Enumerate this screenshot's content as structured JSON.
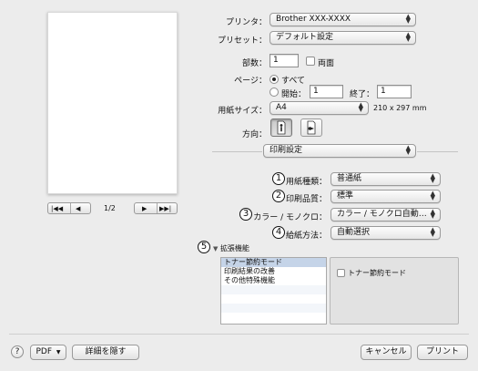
{
  "preview": {
    "page_counter": "1/2",
    "nav_first": "|◀◀",
    "nav_prev": "◀",
    "nav_next": "▶",
    "nav_last": "▶▶|"
  },
  "printer": {
    "label": "プリンタ：",
    "value": "Brother XXX-XXXX"
  },
  "preset": {
    "label": "プリセット：",
    "value": "デフォルト設定"
  },
  "copies": {
    "label": "部数：",
    "value": "1",
    "duplex_label": "両面",
    "duplex_checked": false
  },
  "pages": {
    "label": "ページ：",
    "all_label": "すべて",
    "from_label": "開始：",
    "from_value": "1",
    "to_label": "終了：",
    "to_value": "1",
    "selected": "all"
  },
  "paper_size": {
    "label": "用紙サイズ：",
    "value": "A4",
    "dimensions": "210 x 297 mm"
  },
  "orientation": {
    "label": "方向："
  },
  "section": {
    "value": "印刷設定"
  },
  "settings": [
    {
      "number": "1",
      "label": "用紙種類：",
      "value": "普通紙"
    },
    {
      "number": "2",
      "label": "印刷品質：",
      "value": "標準"
    },
    {
      "number": "3",
      "label": "カラー / モノクロ：",
      "value": "カラー / モノクロ自動…"
    },
    {
      "number": "4",
      "label": "給紙方法：",
      "value": "自動選択"
    }
  ],
  "advanced": {
    "number": "5",
    "label": "拡張機能",
    "items": [
      "トナー節約モード",
      "印刷結果の改善",
      "その他特殊機能"
    ],
    "selected_index": 0,
    "toner_save_label": "トナー節約モード",
    "toner_save_checked": false
  },
  "footer": {
    "help": "?",
    "pdf": "PDF",
    "hide_details": "詳細を隠す",
    "cancel": "キャンセル",
    "print": "プリント"
  },
  "colors": {
    "accent": "#3a83d6",
    "selection": "#c5d4e8"
  }
}
